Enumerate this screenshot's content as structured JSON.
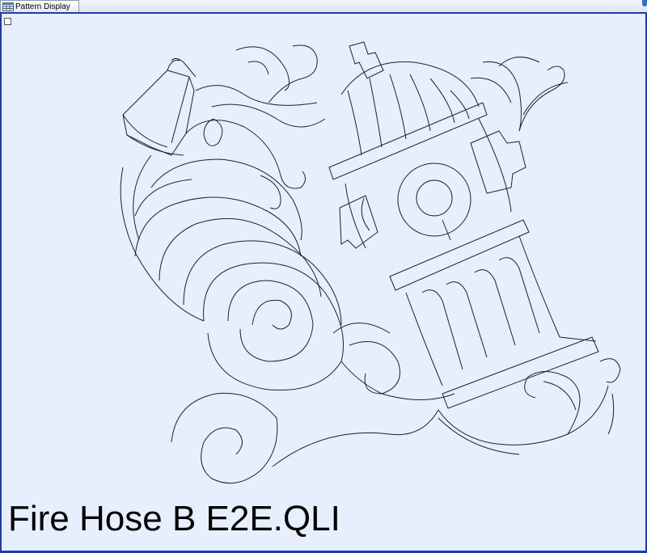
{
  "window": {
    "tab_label": "Pattern Display",
    "tab_icon": "grid-window-icon"
  },
  "panel": {
    "pattern_name": "Fire Hose B E2E.QLI"
  },
  "colors": {
    "panel_border": "#1f3aa6",
    "canvas_background": "#e7effd",
    "line_color": "#222222"
  }
}
